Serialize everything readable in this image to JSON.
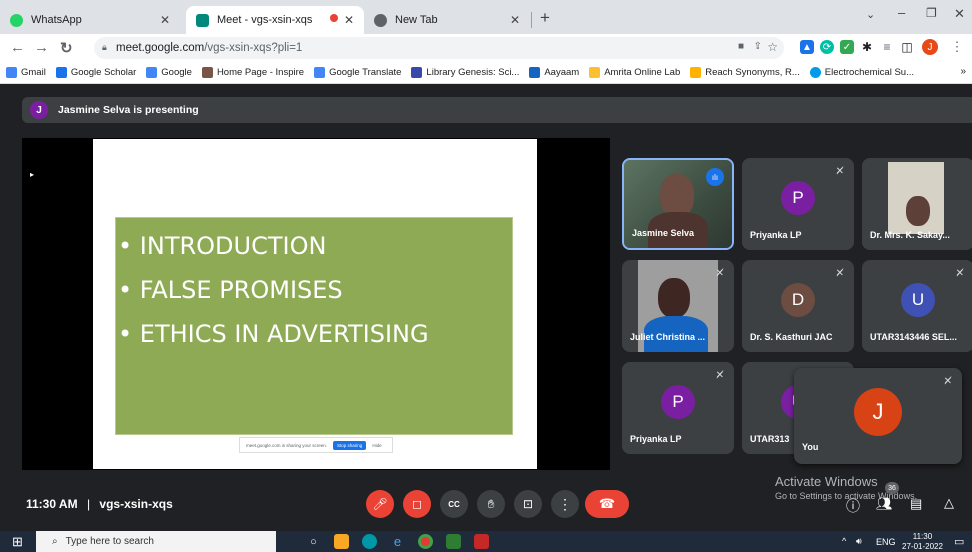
{
  "tabs": [
    {
      "title": "WhatsApp",
      "active": false
    },
    {
      "title": "Meet - vgs-xsin-xqs",
      "active": true
    },
    {
      "title": "New Tab",
      "active": false
    }
  ],
  "address": {
    "host": "meet.google.com",
    "path": "/vgs-xsin-xqs?pli=1"
  },
  "bookmarks": [
    "Gmail",
    "Google Scholar",
    "Google",
    "Home Page - Inspire",
    "Google Translate",
    "Library Genesis: Sci...",
    "Aayaam",
    "Amrita Online Lab",
    "Reach Synonyms, R...",
    "Electrochemical Su..."
  ],
  "presenting": {
    "avatar_letter": "J",
    "text": "Jasmine Selva is presenting"
  },
  "slide": {
    "bullets": [
      "• INTRODUCTION",
      "• FALSE PROMISES",
      "• ETHICS IN ADVERTISING"
    ],
    "share_text": "meet.google.com is sharing your screen.",
    "stop_label": "Stop sharing",
    "hide_label": "Hide"
  },
  "participants": [
    {
      "name": "Jasmine Selva",
      "letter": ""
    },
    {
      "name": "Priyanka LP",
      "letter": "P",
      "color": "#7b1fa2"
    },
    {
      "name": "Dr. Mrs. K. Sakay...",
      "letter": ""
    },
    {
      "name": "Juliet Christina ...",
      "letter": ""
    },
    {
      "name": "Dr. S. Kasthuri JAC",
      "letter": "D",
      "color": "#6d4c41"
    },
    {
      "name": "UTAR3143446 SEL...",
      "letter": "U",
      "color": "#3f51b5"
    },
    {
      "name": "Priyanka LP",
      "letter": "P",
      "color": "#7b1fa2"
    },
    {
      "name": "UTAR313",
      "letter": "U",
      "color": "#7b1fa2"
    },
    {
      "name": "You",
      "letter": "J",
      "color": "#d84315"
    }
  ],
  "meeting": {
    "time": "11:30 AM",
    "separator": "|",
    "code": "vgs-xsin-xqs"
  },
  "activate": {
    "title": "Activate Windows",
    "subtitle": "Go to Settings to activate Windows."
  },
  "badge_count": "36",
  "taskbar": {
    "search_placeholder": "Type here to search",
    "lang": "ENG",
    "clock": "11:30",
    "date": "27-01-2022"
  }
}
